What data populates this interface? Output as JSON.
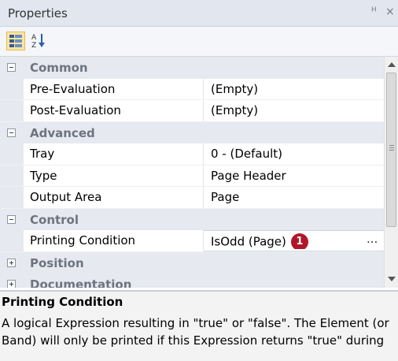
{
  "panel": {
    "title": "Properties",
    "pin_label": "ᵸ",
    "close_label": "×"
  },
  "toolbar": {
    "categorized_icon": "categorized-view-icon",
    "alphabetical_icon": "sort-az-icon"
  },
  "grid": {
    "common": {
      "label": "Common",
      "pre_eval_name": "Pre-Evaluation",
      "pre_eval_value": "(Empty)",
      "post_eval_name": "Post-Evaluation",
      "post_eval_value": "(Empty)"
    },
    "advanced": {
      "label": "Advanced",
      "tray_name": "Tray",
      "tray_value": "0 - (Default)",
      "type_name": "Type",
      "type_value": "Page Header",
      "output_name": "Output Area",
      "output_value": "Page"
    },
    "control": {
      "label": "Control",
      "printing_name": "Printing Condition",
      "printing_value": "IsOdd (Page)",
      "badge": "1",
      "ellipsis": "..."
    },
    "position": {
      "label": "Position"
    },
    "documentation": {
      "label": "Documentation"
    }
  },
  "description": {
    "title": "Printing Condition",
    "text": "A logical Expression resulting in \"true\" or \"false\". The Element (or Band) will only be printed if this Expression returns \"true\" during"
  },
  "colors": {
    "category_bg": "#e6e9ef",
    "badge": "#b0182a",
    "category_text": "#6c7480"
  }
}
